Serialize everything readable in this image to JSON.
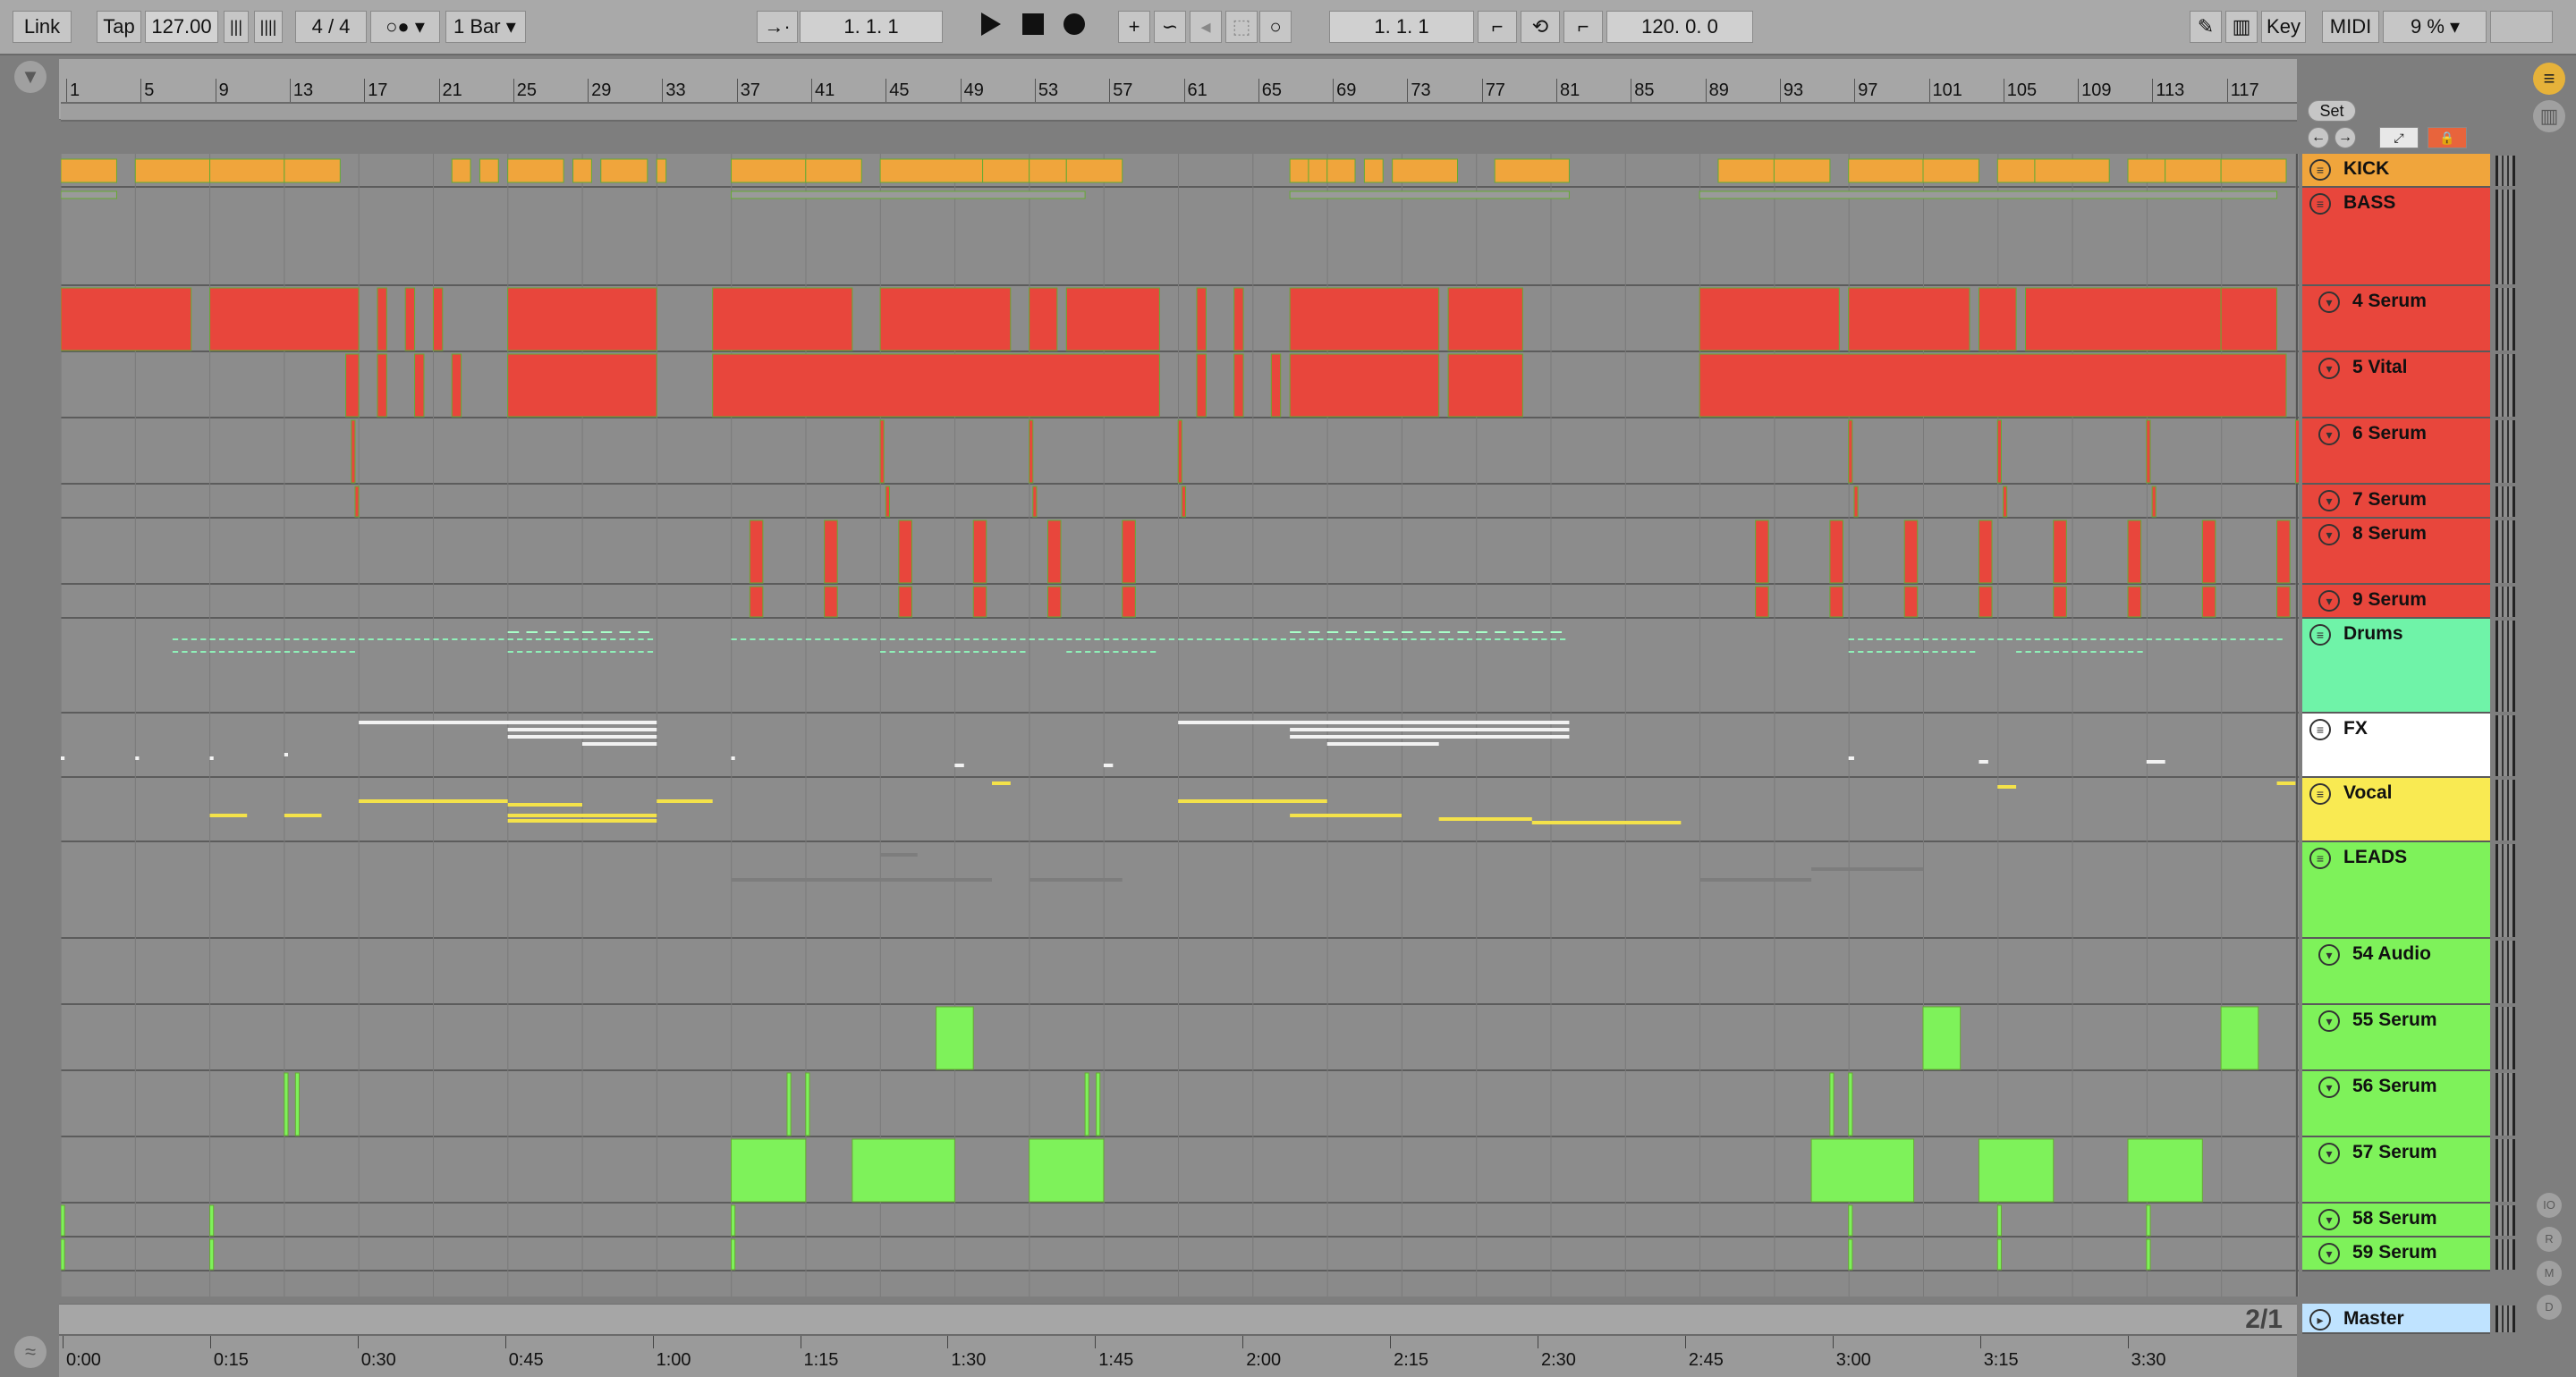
{
  "transport": {
    "link": "Link",
    "tap": "Tap",
    "tempo": "127.00",
    "signature": "4 / 4",
    "quantize": "1 Bar",
    "arrangement_position": "1.   1.   1",
    "loop_start": "1.   1.   1",
    "loop_length": "120.   0.   0",
    "key_label": "Key",
    "midi_label": "MIDI",
    "cpu": "9 %"
  },
  "ruler": {
    "bars": [
      "1",
      "5",
      "9",
      "13",
      "17",
      "21",
      "25",
      "29",
      "33",
      "37",
      "41",
      "45",
      "49",
      "53",
      "57",
      "61",
      "65",
      "69",
      "73",
      "77",
      "81",
      "85",
      "89",
      "93",
      "97",
      "101",
      "105",
      "109",
      "113",
      "117"
    ]
  },
  "set_button": "Set",
  "time_axis": {
    "labels": [
      "0:00",
      "0:15",
      "0:30",
      "0:45",
      "1:00",
      "1:15",
      "1:30",
      "1:45",
      "2:00",
      "2:15",
      "2:30",
      "2:45",
      "3:00",
      "3:15",
      "3:30"
    ]
  },
  "page_indicator": "2/1",
  "tracks": [
    {
      "name": "KICK",
      "color": "#f0a53c",
      "kind": "group",
      "h": 38
    },
    {
      "name": "BASS",
      "color": "#e8463c",
      "kind": "group",
      "h": 110
    },
    {
      "name": "4 Serum",
      "color": "#e8463c",
      "kind": "sub",
      "h": 74
    },
    {
      "name": "5 Vital",
      "color": "#e8463c",
      "kind": "sub",
      "h": 74
    },
    {
      "name": "6 Serum",
      "color": "#e8463c",
      "kind": "sub",
      "h": 74
    },
    {
      "name": "7 Serum",
      "color": "#e8463c",
      "kind": "sub",
      "h": 38
    },
    {
      "name": "8 Serum",
      "color": "#e8463c",
      "kind": "sub",
      "h": 74
    },
    {
      "name": "9 Serum",
      "color": "#e8463c",
      "kind": "sub",
      "h": 38
    },
    {
      "name": "Drums",
      "color": "#6ff3a8",
      "kind": "group",
      "h": 106
    },
    {
      "name": "FX",
      "color": "#ffffff",
      "kind": "group",
      "h": 72
    },
    {
      "name": "Vocal",
      "color": "#f9ea52",
      "kind": "group",
      "h": 72
    },
    {
      "name": "LEADS",
      "color": "#7ef25a",
      "kind": "group",
      "h": 108
    },
    {
      "name": "54 Audio",
      "color": "#7ef25a",
      "kind": "sub",
      "h": 74
    },
    {
      "name": "55 Serum",
      "color": "#7ef25a",
      "kind": "sub",
      "h": 74
    },
    {
      "name": "56 Serum",
      "color": "#7ef25a",
      "kind": "sub",
      "h": 74
    },
    {
      "name": "57 Serum",
      "color": "#7ef25a",
      "kind": "sub",
      "h": 74
    },
    {
      "name": "58 Serum",
      "color": "#7ef25a",
      "kind": "sub",
      "h": 38
    },
    {
      "name": "59 Serum",
      "color": "#7ef25a",
      "kind": "sub",
      "h": 38
    }
  ],
  "master": {
    "name": "Master",
    "color": "#bfe3ff"
  },
  "icons": {
    "metronome": "metronome-icon",
    "follow": "follow-icon",
    "play": "play-icon",
    "stop": "stop-icon",
    "record": "record-icon",
    "add": "add-icon",
    "automation": "automation-icon",
    "back": "back-to-arrangement-icon",
    "punch": "punch-icon",
    "loop": "loop-icon",
    "draw": "pencil-icon",
    "keyboard": "keyboard-icon"
  }
}
